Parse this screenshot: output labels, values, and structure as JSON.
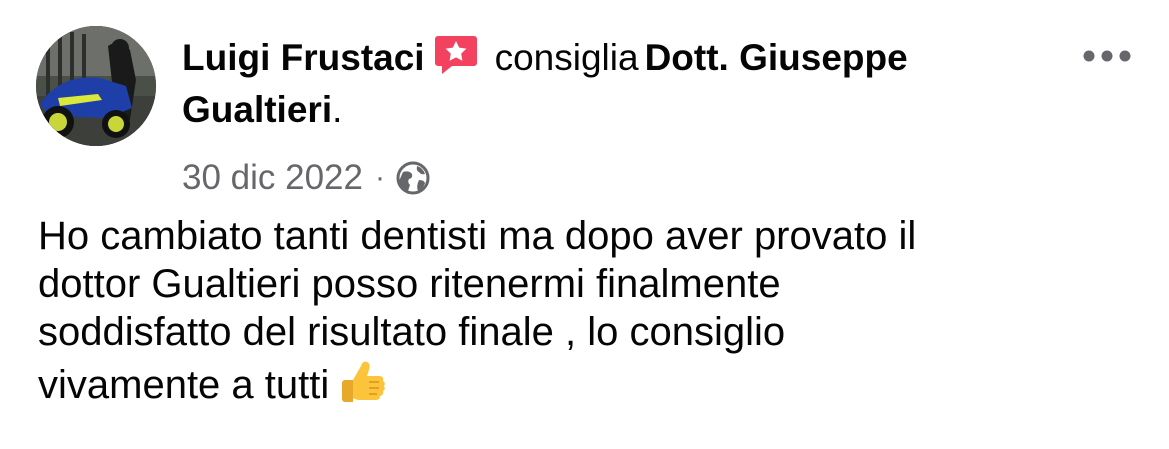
{
  "post": {
    "author_name": "Luigi Frustaci",
    "author_avatar_icon": "avatar-motorcycle",
    "recommend_icon": "recommend-star-icon",
    "recommend_color": "#f3425f",
    "action_text": "consiglia",
    "target_name": "Dott. Giuseppe Gualtieri",
    "target_suffix": ".",
    "date": "30 dic 2022",
    "separator": "·",
    "privacy_icon": "globe-icon",
    "more_icon": "more-options-icon",
    "body_lines": [
      "Ho cambiato tanti dentisti ma dopo aver provato il",
      "dottor Gualtieri posso ritenermi finalmente",
      "soddisfatto del risultato finale , lo consiglio",
      "vivamente a tutti"
    ],
    "body_emoji": "thumbs-up-icon"
  }
}
